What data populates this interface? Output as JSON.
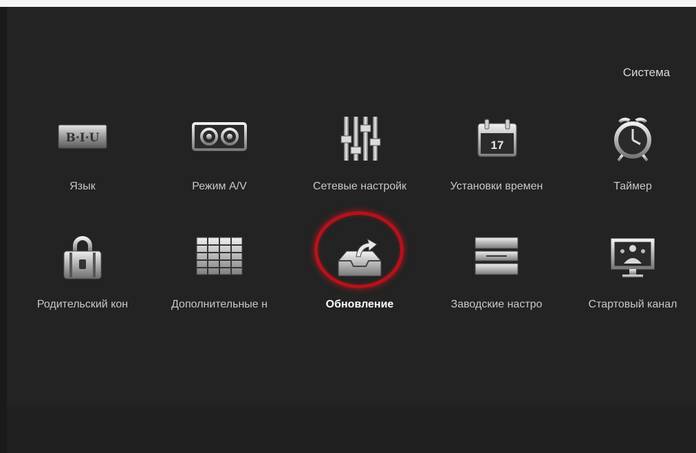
{
  "header": {
    "section_title": "Система"
  },
  "menu": {
    "items": [
      {
        "label": "Язык",
        "icon": "text-format-icon"
      },
      {
        "label": "Режим A/V",
        "icon": "av-ports-icon"
      },
      {
        "label": "Сетевые настройк",
        "icon": "sliders-icon"
      },
      {
        "label": "Установки времен",
        "icon": "calendar-icon",
        "calendar_day": "17"
      },
      {
        "label": "Таймер",
        "icon": "alarm-clock-icon"
      },
      {
        "label": "Родительский кон",
        "icon": "lock-icon"
      },
      {
        "label": "Дополнительные н",
        "icon": "grid-table-icon"
      },
      {
        "label": "Обновление",
        "icon": "upload-tray-icon",
        "selected": true
      },
      {
        "label": "Заводские настро",
        "icon": "factory-reset-icon"
      },
      {
        "label": "Стартовый канал",
        "icon": "startup-channel-icon"
      }
    ]
  },
  "colors": {
    "background": "#232323",
    "accent_ring": "#b5121b",
    "text": "#c8c8c8"
  }
}
